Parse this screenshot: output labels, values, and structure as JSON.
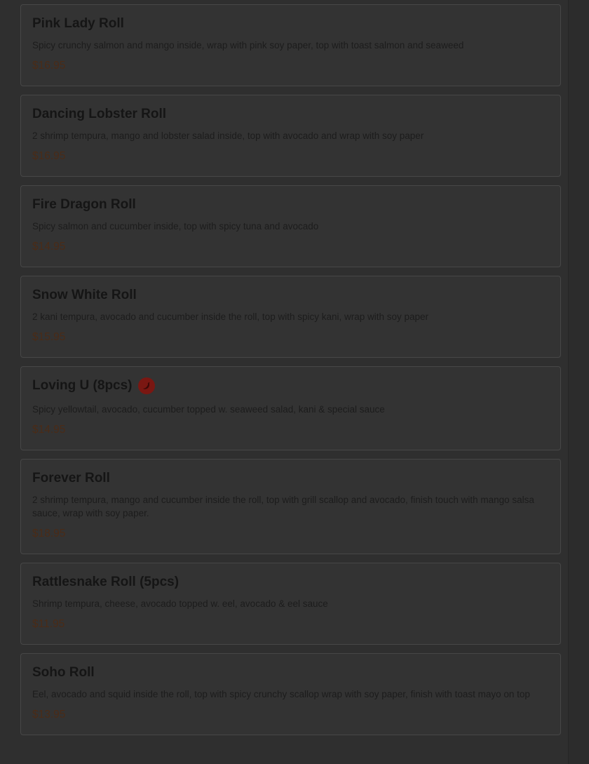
{
  "items": [
    {
      "name": "Pink Lady Roll",
      "description": "Spicy crunchy salmon and mango inside, wrap with pink soy paper, top with toast salmon and seaweed",
      "price": "$16.95"
    },
    {
      "name": "Dancing Lobster Roll",
      "description": "2 shrimp tempura, mango and lobster salad inside, top with avocado and wrap with soy paper",
      "price": "$16.95"
    },
    {
      "name": "Fire Dragon Roll",
      "description": "Spicy salmon and cucumber inside, top with spicy tuna and avocado",
      "price": "$14.95"
    },
    {
      "name": "Snow White Roll",
      "description": "2 kani tempura, avocado and cucumber inside the roll, top with spicy kani, wrap with soy paper",
      "price": "$15.95"
    },
    {
      "name": "Loving U (8pcs)",
      "description": "Spicy yellowtail, avocado, cucumber topped w. seaweed salad, kani & special sauce",
      "price": "$14.95",
      "icon": "spicy-pepper-icon"
    },
    {
      "name": "Forever Roll",
      "description": "2 shrimp tempura, mango and cucumber inside the roll, top with grill scallop and avocado, finish touch with mango salsa sauce, wrap with soy paper.",
      "price": "$18.95"
    },
    {
      "name": "Rattlesnake Roll (5pcs)",
      "description": "Shrimp tempura, cheese, avocado topped w. eel, avocado & eel sauce",
      "price": "$11.95"
    },
    {
      "name": "Soho Roll",
      "description": "Eel, avocado and squid inside the roll, top with spicy crunchy scallop wrap with soy paper, finish with toast mayo on top",
      "price": "$13.95"
    }
  ],
  "colors": {
    "background": "#2f2f2f",
    "card": "#333333",
    "title_text": "#151515",
    "price_text": "#4a2b17",
    "spicy_icon": "#7a1712"
  }
}
